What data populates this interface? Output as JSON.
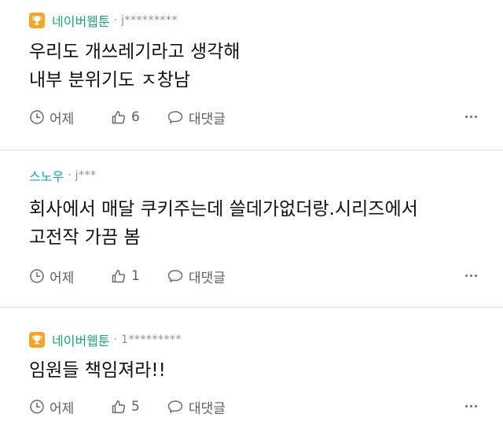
{
  "comments": [
    {
      "author": "네이버웹툰",
      "badge": true,
      "user_id": "j*********",
      "text": "우리도 개쓰레기라고 생각해\n내부 분위기도 ㅈ창남",
      "time": "어제",
      "likes": "6",
      "reply_label": "대댓글"
    },
    {
      "author": "스노우",
      "badge": false,
      "user_id": "j***",
      "text": "회사에서 매달 쿠키주는데 쓸데가없더랑.시리즈에서\n고전작 가끔 봄",
      "time": "어제",
      "likes": "1",
      "reply_label": "대댓글"
    },
    {
      "author": "네이버웹툰",
      "badge": true,
      "user_id": "1*********",
      "text": "임원들 책임져라!!",
      "time": "어제",
      "likes": "5",
      "reply_label": "대댓글"
    }
  ],
  "colors": {
    "badge": "#f5a524",
    "author_badge": "#1aa37a",
    "author_plain": "#1f9fb8",
    "meta": "#8f8f8f",
    "separator": "#e5e5e5"
  },
  "icons": {
    "badge": "trophy-icon",
    "time": "clock-icon",
    "like": "thumbs-up-icon",
    "reply": "speech-bubble-icon",
    "more": "more-options-icon"
  }
}
